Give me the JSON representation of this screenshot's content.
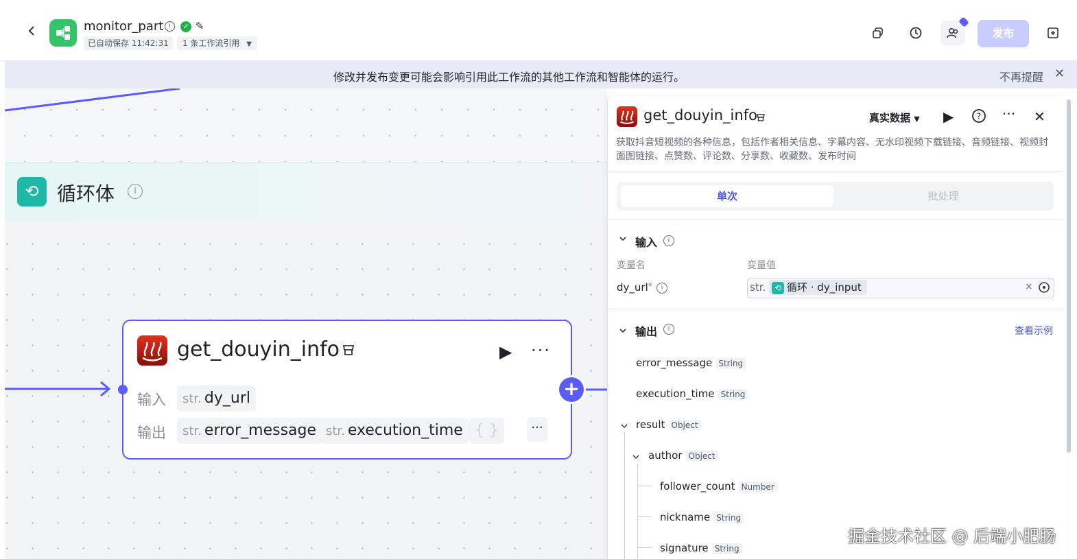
{
  "header": {
    "title": "monitor_part",
    "autosave": "已自动保存 11:42:31",
    "references": "1 条工作流引用",
    "publish_label": "发布"
  },
  "notice": {
    "text": "修改并发布变更可能会影响引用此工作流的其他工作流和智能体的运行。",
    "dismiss": "不再提醒"
  },
  "canvas": {
    "loop_title": "循环体",
    "node": {
      "title": "get_douyin_info",
      "input_label": "输入",
      "output_label": "输出",
      "input_type": "str.",
      "input_name": "dy_url",
      "outputs": [
        {
          "type": "str.",
          "name": "error_message"
        },
        {
          "type": "str.",
          "name": "execution_time"
        }
      ],
      "more_outputs": "{ }"
    }
  },
  "panel": {
    "title": "get_douyin_info",
    "data_mode": "真实数据",
    "description": "获取抖音短视频的各种信息，包括作者相关信息、字幕内容、无水印视频下载链接、音频链接、视频封面图链接、点赞数、评论数、分享数、收藏数、发布时间",
    "tabs": [
      "单次",
      "批处理"
    ],
    "input_section": "输入",
    "col_name": "变量名",
    "col_value": "变量值",
    "input_var": "dy_url",
    "input_required": "*",
    "input_type": "str.",
    "input_ref": "循环 · dy_input",
    "output_section": "输出",
    "view_example": "查看示例",
    "outputs": [
      {
        "name": "error_message",
        "type": "String"
      },
      {
        "name": "execution_time",
        "type": "String"
      },
      {
        "name": "result",
        "type": "Object"
      },
      {
        "name": "author",
        "type": "Object"
      },
      {
        "name": "follower_count",
        "type": "Number"
      },
      {
        "name": "nickname",
        "type": "String"
      },
      {
        "name": "signature",
        "type": "String"
      }
    ]
  },
  "watermark": "掘金技术社区 @ 后端小肥肠",
  "colors": {
    "accent": "#5b5cff",
    "loop": "#1fb7a6",
    "brand_green": "#35c46a"
  }
}
